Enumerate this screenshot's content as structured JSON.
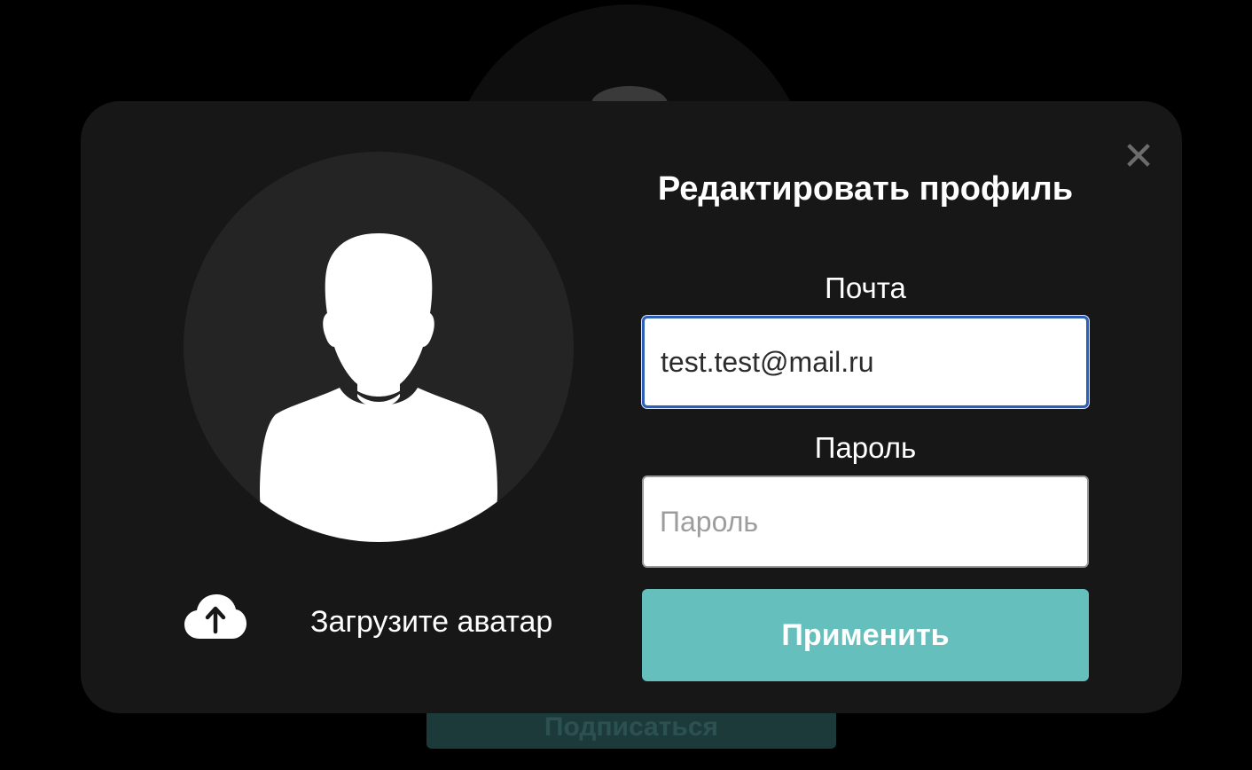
{
  "background_page": {
    "button_label": "Подписаться"
  },
  "modal": {
    "title": "Редактировать профиль",
    "close_icon": "close-icon",
    "avatar_icon": "user-silhouette-icon",
    "upload": {
      "icon": "cloud-upload-icon",
      "label": "Загрузите аватар"
    },
    "email": {
      "label": "Почта",
      "value": "test.test@mail.ru"
    },
    "password": {
      "label": "Пароль",
      "placeholder": "Пароль",
      "value": ""
    },
    "apply_label": "Применить"
  },
  "colors": {
    "modal_bg": "#171717",
    "accent": "#64bfbd",
    "focus_border": "#2c5fb8"
  }
}
